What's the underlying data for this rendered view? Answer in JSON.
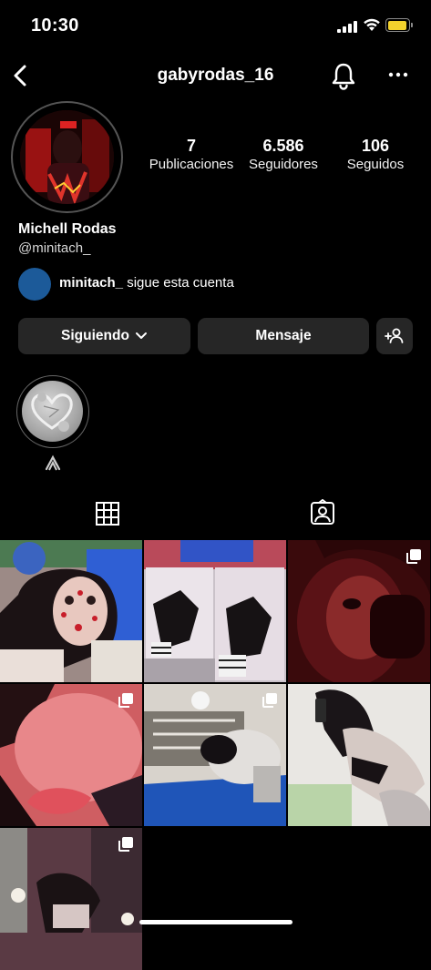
{
  "status_bar": {
    "time": "10:30"
  },
  "header": {
    "username": "gabyrodas_16"
  },
  "profile": {
    "stats": [
      {
        "value": "7",
        "label": "Publicaciones"
      },
      {
        "value": "6.586",
        "label": "Seguidores"
      },
      {
        "value": "106",
        "label": "Seguidos"
      }
    ],
    "full_name": "Michell Rodas",
    "handle": "@minitach_",
    "followed_by": {
      "user": "minitach_",
      "text": "sigue esta cuenta"
    }
  },
  "buttons": {
    "following": "Siguiendo",
    "message": "Mensaje"
  },
  "highlights": [
    {
      "label": ""
    }
  ],
  "tabs": [
    {
      "name": "grid"
    },
    {
      "name": "tagged"
    }
  ],
  "posts": [
    {
      "multiple": false
    },
    {
      "multiple": false
    },
    {
      "multiple": true
    },
    {
      "multiple": true
    },
    {
      "multiple": true
    },
    {
      "multiple": false
    },
    {
      "multiple": true
    }
  ],
  "colors": {
    "background": "#000000",
    "button": "#262626",
    "battery": "#f2d22d",
    "mini_avatar": "#1c5a99"
  }
}
